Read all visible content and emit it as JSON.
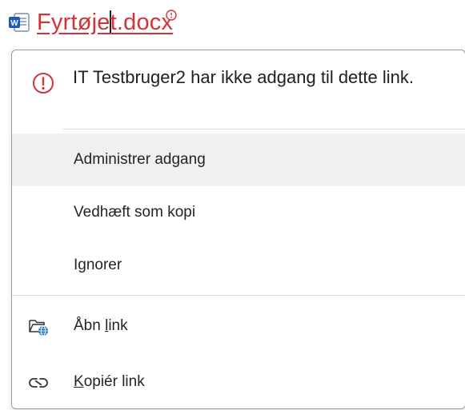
{
  "link": {
    "text_before_caret": "Fyrtøje",
    "text_after_caret": "t.docx",
    "color": "#d13438"
  },
  "icons": {
    "document": "word-doc-icon",
    "badge": "info-circle-icon",
    "warning": "exclamation-circle-icon",
    "open_link": "folder-globe-icon",
    "copy_link": "link-icon"
  },
  "warning": {
    "message": "IT Testbruger2 har ikke adgang til dette link."
  },
  "menu": {
    "manage_access": "Administrer adgang",
    "attach_copy": "Vedhæft som kopi",
    "ignore": "Ignorer",
    "open_link": {
      "before": "Åbn ",
      "underlined": "l",
      "after": "ink"
    },
    "copy_link": {
      "before": "",
      "underlined": "K",
      "after": "opiér link"
    }
  },
  "colors": {
    "accent_red": "#d13438",
    "word_blue": "#185abd",
    "globe_blue": "#0f6cbd",
    "hover_bg": "#f0f0f0"
  }
}
